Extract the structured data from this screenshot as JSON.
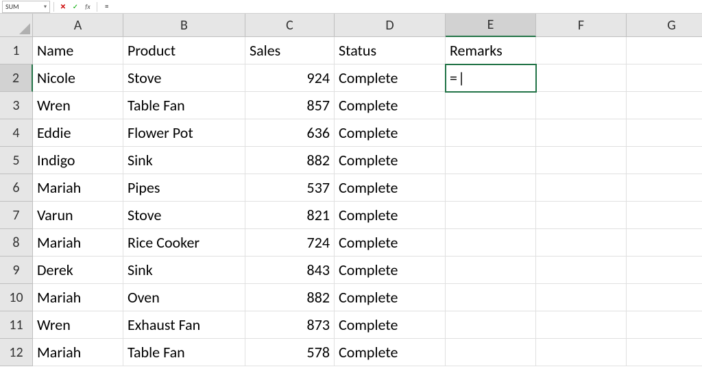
{
  "formulaBar": {
    "nameBox": "SUM",
    "cancelIcon": "✕",
    "enterIcon": "✓",
    "fxIcon": "fx",
    "formulaText": "="
  },
  "columns": [
    "A",
    "B",
    "C",
    "D",
    "E",
    "F",
    "G"
  ],
  "rows": [
    "1",
    "2",
    "3",
    "4",
    "5",
    "6",
    "7",
    "8",
    "9",
    "10",
    "11",
    "12"
  ],
  "activeCell": {
    "col": "E",
    "row": "2",
    "display": "="
  },
  "headers": {
    "A": "Name",
    "B": "Product",
    "C": "Sales",
    "D": "Status",
    "E": "Remarks"
  },
  "data": [
    {
      "A": "Nicole",
      "B": "Stove",
      "C": "924",
      "D": "Complete"
    },
    {
      "A": "Wren",
      "B": "Table Fan",
      "C": "857",
      "D": "Complete"
    },
    {
      "A": "Eddie",
      "B": "Flower Pot",
      "C": "636",
      "D": "Complete"
    },
    {
      "A": "Indigo",
      "B": "Sink",
      "C": "882",
      "D": "Complete"
    },
    {
      "A": "Mariah",
      "B": "Pipes",
      "C": "537",
      "D": "Complete"
    },
    {
      "A": "Varun",
      "B": "Stove",
      "C": "821",
      "D": "Complete"
    },
    {
      "A": "Mariah",
      "B": "Rice Cooker",
      "C": "724",
      "D": "Complete"
    },
    {
      "A": "Derek",
      "B": "Sink",
      "C": "843",
      "D": "Complete"
    },
    {
      "A": "Mariah",
      "B": "Oven",
      "C": "882",
      "D": "Complete"
    },
    {
      "A": "Wren",
      "B": "Exhaust Fan",
      "C": "873",
      "D": "Complete"
    },
    {
      "A": "Mariah",
      "B": "Table Fan",
      "C": "578",
      "D": "Complete"
    }
  ]
}
